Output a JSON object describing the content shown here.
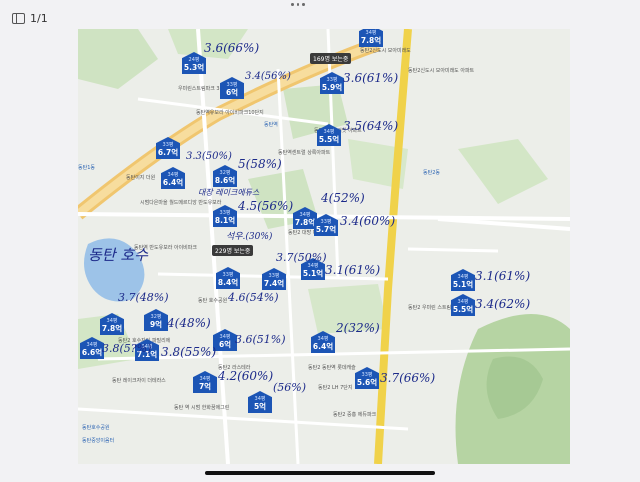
{
  "toolbar": {
    "page_indicator": "1/1"
  },
  "tags": [
    {
      "id": "tag-169",
      "text": "169명 보는중"
    },
    {
      "id": "tag-229",
      "text": "229명 보는중"
    }
  ],
  "pins": [
    {
      "top": "24평",
      "value": "5.3억"
    },
    {
      "top": "33평",
      "value": "6억"
    },
    {
      "top": "33평",
      "value": "5.9억"
    },
    {
      "top": "34평",
      "value": "7.8억"
    },
    {
      "top": "34평",
      "value": "5.5억"
    },
    {
      "top": "33평",
      "value": "6.7억"
    },
    {
      "top": "32평",
      "value": "8.6억"
    },
    {
      "top": "34평",
      "value": "6.4억"
    },
    {
      "top": "33평",
      "value": "8.1억"
    },
    {
      "top": "34평",
      "value": "7.8억"
    },
    {
      "top": "33평",
      "value": "5.7억"
    },
    {
      "top": "33평",
      "value": "8.4억"
    },
    {
      "top": "33평",
      "value": "7.4억"
    },
    {
      "top": "34평",
      "value": "5.1억"
    },
    {
      "top": "34평",
      "value": "5.1억"
    },
    {
      "top": "34평",
      "value": "5.5억"
    },
    {
      "top": "34평",
      "value": "7.8억"
    },
    {
      "top": "32평",
      "value": "9억"
    },
    {
      "top": "34평",
      "value": "6억"
    },
    {
      "top": "34평",
      "value": "6.4억"
    },
    {
      "top": "34평",
      "value": "6.6억"
    },
    {
      "top": "34평",
      "value": "7.1억"
    },
    {
      "top": "34평",
      "value": "7억"
    },
    {
      "top": "34평",
      "value": "5억"
    },
    {
      "top": "33평",
      "value": "5.6억"
    }
  ],
  "notes": [
    "3.6(66%)",
    "3.4(56%)",
    "3.6(61%)",
    "3.5(64%)",
    "3.3(50%)",
    "5(58%)",
    "4.5(56%)",
    "4(52%)",
    "3.4(60%)",
    "3.7(50%)",
    "3.1(61%)",
    "3.1(61%)",
    "4.6(54%)",
    "3.4(62%)",
    "3.7(48%)",
    "4(48%)",
    "3.6(51%)",
    "2(32%)",
    "3.8(5?%)",
    "3.8(55%)",
    "4.2(60%)",
    "3.7(66%)",
    "(56%)",
    "동탄 호수",
    "대장 레이크에듀스",
    "석우.(30%)"
  ],
  "labels": [
    "동탄2신도시 모아미래도",
    "동탄2신도시 모아미래도 아파트",
    "우미린스트림파크 3.0아파트",
    "동탄역유보라 아이비파크10단지",
    "동탄2호반 써밋 아파트",
    "동탄역센트럴 상록아파트",
    "동탄이지 더원",
    "시범다은마을 월드메르디앙 반도유보라",
    "동탄역 반도유보라 아이비파크",
    "동탄 호수공원",
    "동탄2 호수자이 파밀리에",
    "동탄2 라스테라",
    "동탄 레이크자이 더테라스",
    "동탄 역 시범 한화꿈에그린",
    "동탄2 동탄역 롯데캐슬",
    "동탄2 대방 디엠시티",
    "동탄2 우미린 스트림파크",
    "동탄2 LH 7단지",
    "동탄2 중흥 에듀파크"
  ],
  "blue_labels": [
    "동탄역",
    "동탄2동",
    "동탄호수공원",
    "동탄중앙이음터",
    "동탄1동"
  ]
}
